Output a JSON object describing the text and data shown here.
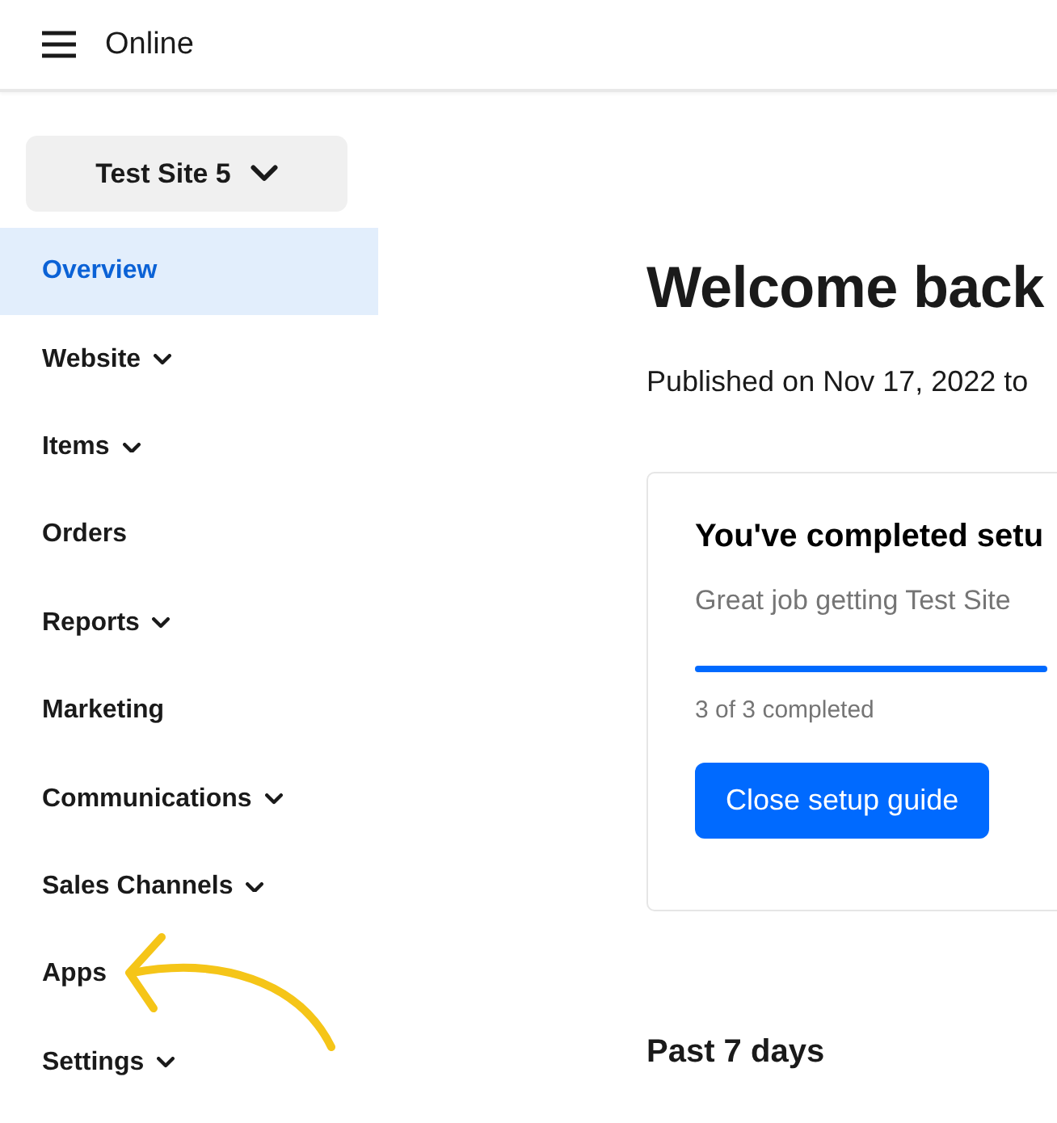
{
  "header": {
    "title": "Online"
  },
  "site_selector": {
    "label": "Test Site 5"
  },
  "sidebar": {
    "items": [
      {
        "label": "Overview",
        "selected": true,
        "has_submenu": false
      },
      {
        "label": "Website",
        "selected": false,
        "has_submenu": true
      },
      {
        "label": "Items",
        "selected": false,
        "has_submenu": true
      },
      {
        "label": "Orders",
        "selected": false,
        "has_submenu": false
      },
      {
        "label": "Reports",
        "selected": false,
        "has_submenu": true
      },
      {
        "label": "Marketing",
        "selected": false,
        "has_submenu": false
      },
      {
        "label": "Communications",
        "selected": false,
        "has_submenu": true
      },
      {
        "label": "Sales Channels",
        "selected": false,
        "has_submenu": true
      },
      {
        "label": "Apps",
        "selected": false,
        "has_submenu": false
      },
      {
        "label": "Settings",
        "selected": false,
        "has_submenu": true
      }
    ]
  },
  "main": {
    "title": "Welcome back",
    "published": "Published on Nov 17, 2022 to",
    "setup_card": {
      "title": "You've completed setu",
      "subtitle": "Great job getting Test Site",
      "level": 1,
      "progress_text": "3 of 3 completed",
      "button": "Close setup guide"
    },
    "section_title": "Past 7 days"
  }
}
